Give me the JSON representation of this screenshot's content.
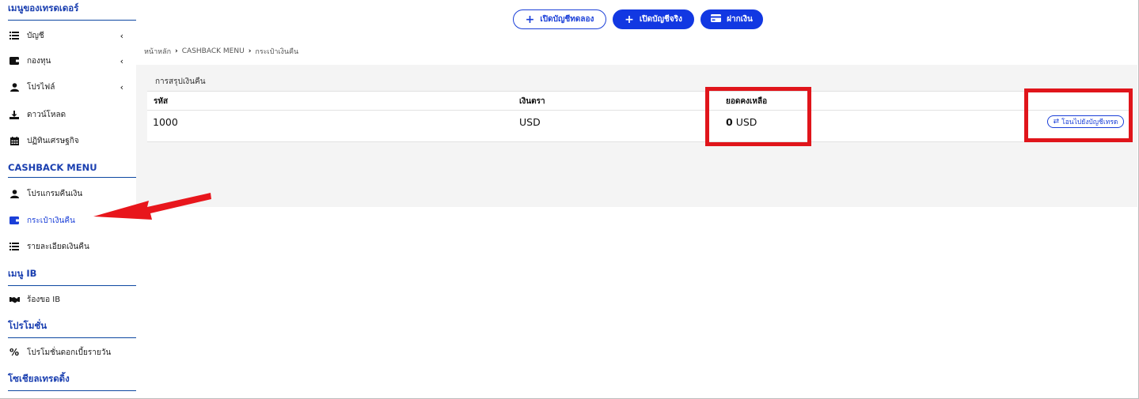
{
  "sidebar": {
    "top_heading": "เมนูของเทรดเดอร์",
    "items": [
      {
        "label": "บัญชี",
        "icon": "list-icon"
      },
      {
        "label": "กองทุน",
        "icon": "wallet-icon"
      },
      {
        "label": "โปรไฟล์",
        "icon": "user-icon"
      },
      {
        "label": "ดาวน์โหลด",
        "icon": "download-icon"
      },
      {
        "label": "ปฏิทินเศรษฐกิจ",
        "icon": "calendar-icon"
      }
    ],
    "cashback_heading": "CASHBACK MENU",
    "cashback_items": [
      {
        "label": "โปรแกรมคืนเงิน",
        "icon": "user-icon"
      },
      {
        "label": "กระเป๋าเงินคืน",
        "icon": "wallet-icon"
      },
      {
        "label": "รายละเอียดเงินคืน",
        "icon": "list-icon"
      }
    ],
    "ib_heading": "เมนู IB",
    "ib_items": [
      {
        "label": "ร้องขอ IB",
        "icon": "handshake-icon"
      }
    ],
    "promo_heading": "โปรโมชั่น",
    "promo_items": [
      {
        "label": "โปรโมชั่นดอกเบี้ยรายวัน",
        "icon": "percent-icon"
      }
    ],
    "social_heading": "โซเชียลเทรดดิ้ง"
  },
  "topbar": {
    "demo_button": "เปิดบัญชีทดลอง",
    "real_button": "เปิดบัญชีจริง",
    "deposit_button": "ฝากเงิน"
  },
  "breadcrumb": {
    "home": "หน้าหลัก",
    "section": "CASHBACK MENU",
    "current": "กระเป๋าเงินคืน"
  },
  "summary": {
    "title": "การสรุปเงินคืน",
    "columns": [
      "รหัส",
      "เงินตรา",
      "ยอดคงเหลือ"
    ],
    "row": {
      "id": "1000",
      "currency": "USD",
      "balance_value": "0",
      "balance_currency": "USD"
    },
    "transfer_button": "โอนไปยังบัญชีเทรด"
  },
  "colors": {
    "accent": "#1238e2",
    "annotation_red": "#e0151b",
    "panel_bg": "#f4f4f4"
  }
}
